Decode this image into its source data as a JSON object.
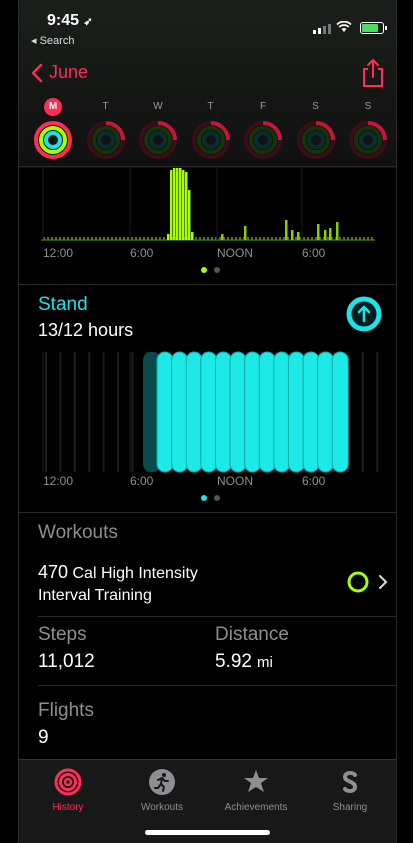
{
  "status": {
    "time": "9:45",
    "back_app": "◂ Search"
  },
  "nav": {
    "back_label": "June"
  },
  "days": [
    {
      "label": "M",
      "selected": true
    },
    {
      "label": "T",
      "selected": false
    },
    {
      "label": "W",
      "selected": false
    },
    {
      "label": "T",
      "selected": false
    },
    {
      "label": "F",
      "selected": false
    },
    {
      "label": "S",
      "selected": false
    },
    {
      "label": "S",
      "selected": false
    }
  ],
  "exercise_chart": {
    "tick_labels": [
      "12:00",
      "6:00",
      "NOON",
      "6:00"
    ]
  },
  "stand": {
    "title": "Stand",
    "value": "13/12 hours",
    "tick_labels": [
      "12:00",
      "6:00",
      "NOON",
      "6:00"
    ]
  },
  "workouts": {
    "title": "Workouts",
    "item_cal": "470",
    "item_cal_unit": "Cal",
    "item_line1": "High Intensity",
    "item_line2": "Interval Training"
  },
  "steps": {
    "label": "Steps",
    "value": "11,012"
  },
  "distance": {
    "label": "Distance",
    "value": "5.92",
    "unit": "mi"
  },
  "flights": {
    "label": "Flights",
    "value": "9"
  },
  "tabs": [
    {
      "label": "History",
      "active": true
    },
    {
      "label": "Workouts",
      "active": false
    },
    {
      "label": "Achievements",
      "active": false
    },
    {
      "label": "Sharing",
      "active": false
    }
  ],
  "colors": {
    "move": "#ff2d55",
    "exercise": "#a6ff00",
    "stand": "#1ee3e6",
    "stand_active": "#1de9e6",
    "stand_dim": "#0b4a4a"
  }
}
